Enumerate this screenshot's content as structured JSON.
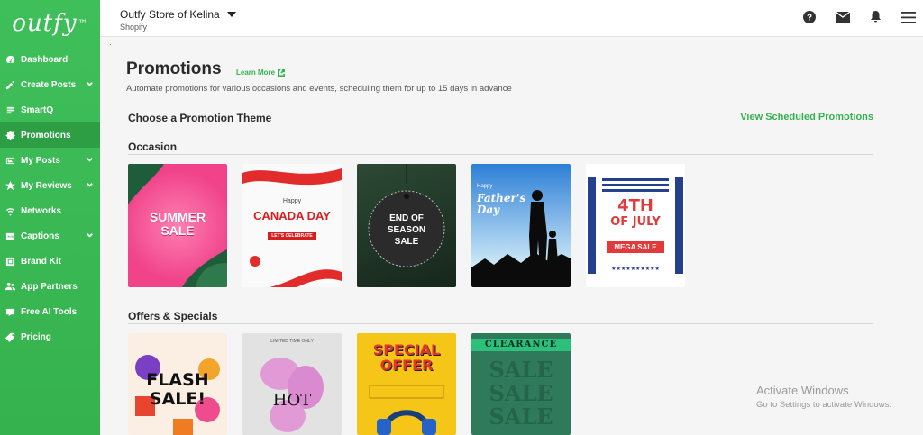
{
  "app": {
    "logo_text": "outfy",
    "logo_mark": "™"
  },
  "sidebar": {
    "items": [
      {
        "label": "Dashboard",
        "icon": "dashboard-icon",
        "has_submenu": false,
        "active": false
      },
      {
        "label": "Create Posts",
        "icon": "pencil-icon",
        "has_submenu": true,
        "active": false
      },
      {
        "label": "SmartQ",
        "icon": "smartq-icon",
        "has_submenu": false,
        "active": false
      },
      {
        "label": "Promotions",
        "icon": "promotions-icon",
        "has_submenu": false,
        "active": true
      },
      {
        "label": "My Posts",
        "icon": "posts-icon",
        "has_submenu": true,
        "active": false
      },
      {
        "label": "My Reviews",
        "icon": "star-icon",
        "has_submenu": true,
        "active": false
      },
      {
        "label": "Networks",
        "icon": "wifi-icon",
        "has_submenu": false,
        "active": false
      },
      {
        "label": "Captions",
        "icon": "captions-icon",
        "has_submenu": true,
        "active": false
      },
      {
        "label": "Brand Kit",
        "icon": "brand-kit-icon",
        "has_submenu": false,
        "active": false
      },
      {
        "label": "App Partners",
        "icon": "partners-icon",
        "has_submenu": false,
        "active": false
      },
      {
        "label": "Free AI Tools",
        "icon": "ai-tools-icon",
        "has_submenu": false,
        "active": false
      },
      {
        "label": "Pricing",
        "icon": "tag-icon",
        "has_submenu": false,
        "active": false
      }
    ]
  },
  "header": {
    "store_name": "Outfy Store of Kelina",
    "platform": "Shopify",
    "icons": [
      "help-icon",
      "mail-icon",
      "bell-icon",
      "menu-icon"
    ]
  },
  "main": {
    "dot": "·",
    "title": "Promotions",
    "learn_more": "Learn More",
    "subtitle": "Automate promotions for various occasions and events, scheduling them for up to 15 days in advance",
    "choose_theme": "Choose a Promotion Theme",
    "view_scheduled": "View Scheduled Promotions",
    "sections": [
      {
        "title": "Occasion",
        "cards": [
          {
            "name": "summer-sale-card",
            "lines": [
              "SUMMER",
              "SALE"
            ]
          },
          {
            "name": "canada-day-card",
            "pre": "Happy",
            "lines": [
              "CANADA DAY"
            ],
            "post": "LET'S CELEBRATE"
          },
          {
            "name": "end-of-season-sale-card",
            "lines": [
              "END OF",
              "SEASON",
              "SALE"
            ]
          },
          {
            "name": "fathers-day-card",
            "pre": "Happy",
            "lines": [
              "Father's",
              "Day"
            ]
          },
          {
            "name": "fourth-of-july-card",
            "lines": [
              "4TH",
              "OF JULY"
            ],
            "post": "MEGA SALE"
          }
        ]
      },
      {
        "title": "Offers & Specials",
        "cards": [
          {
            "name": "flash-sale-card",
            "lines": [
              "FLASH",
              "SALE!"
            ]
          },
          {
            "name": "hot-deal-card",
            "pre": "LIMITED TIME ONLY",
            "lines": [
              "HOT"
            ]
          },
          {
            "name": "special-offer-card",
            "lines": [
              "SPECIAL",
              "OFFER"
            ]
          },
          {
            "name": "clearance-sale-card",
            "pre": "CLEARANCE",
            "lines": [
              "SALE",
              "SALE",
              "SALE"
            ]
          }
        ]
      }
    ]
  },
  "watermark": {
    "title": "Activate Windows",
    "subtitle": "Go to Settings to activate Windows."
  },
  "colors": {
    "brand_green": "#35b24e",
    "active_green": "#2e9e45"
  }
}
